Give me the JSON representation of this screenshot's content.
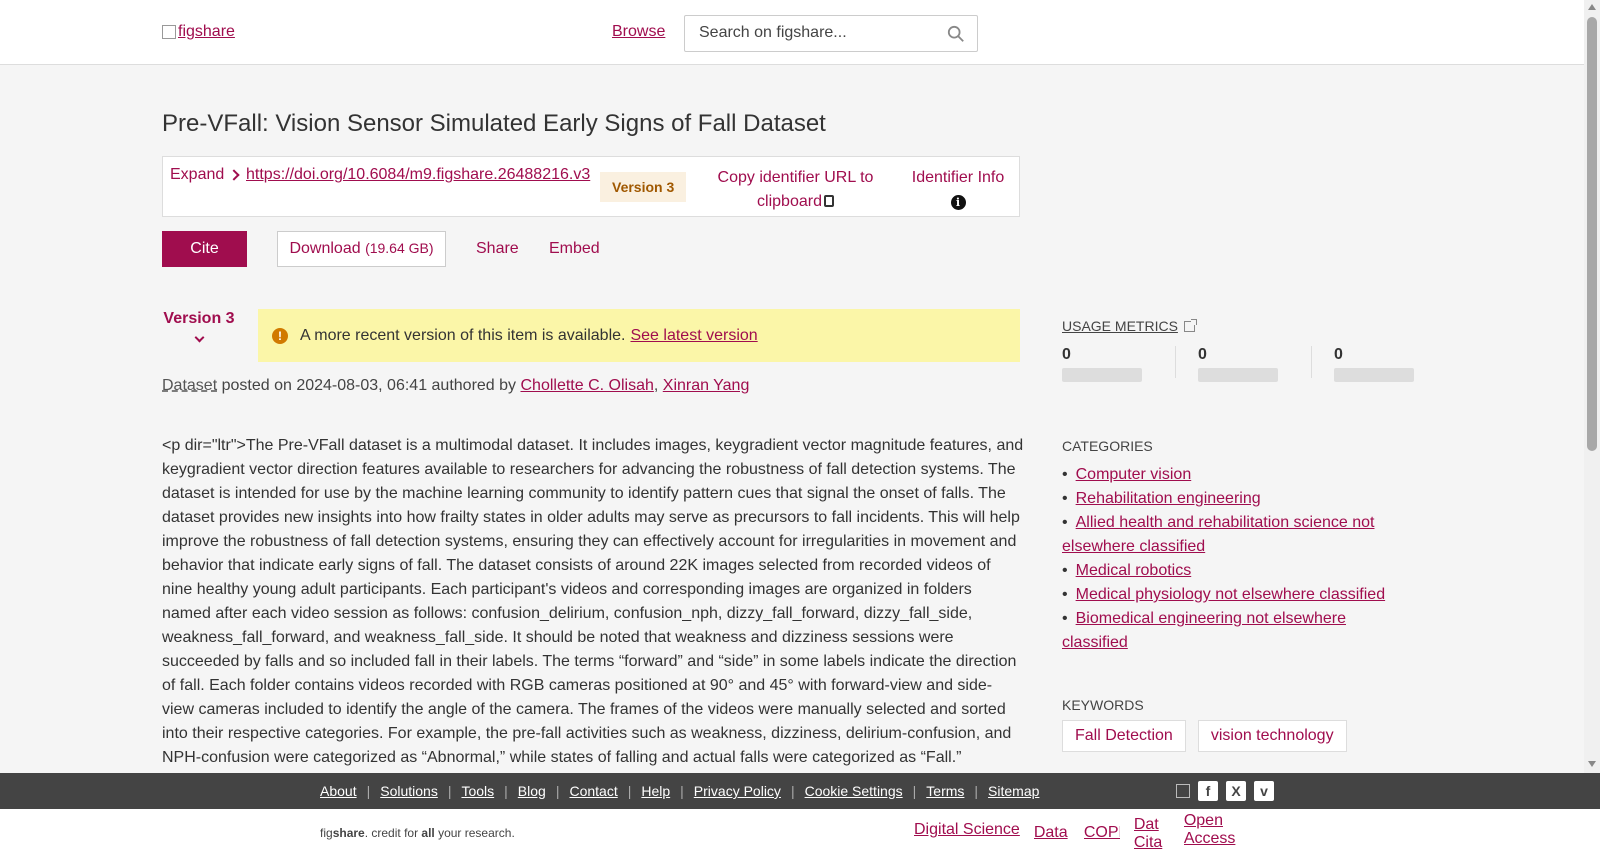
{
  "header": {
    "logo_alt": "figshare",
    "browse": "Browse",
    "search_placeholder": "Search on figshare..."
  },
  "title": "Pre-VFall: Vision Sensor Simulated Early Signs of Fall Dataset",
  "identifier": {
    "expand": "Expand",
    "doi": "https://doi.org/10.6084/m9.figshare.26488216.v3",
    "version_badge": "Version 3",
    "copy_line1": "Copy identifier URL to",
    "copy_line2": "clipboard",
    "info": "Identifier Info"
  },
  "actions": {
    "cite": "Cite",
    "download": "Download",
    "download_size": "(19.64 GB)",
    "share": "Share",
    "embed": "Embed"
  },
  "version_selector": "Version 3",
  "alert": {
    "text": "A more recent version of this item is available.",
    "link": "See latest version"
  },
  "meta": {
    "type": "Dataset",
    "posted_prefix": " posted on 2024-08-03, 06:41 authored by ",
    "author1": "Chollette C. Olisah",
    "sep": ", ",
    "author2": "Xinran Yang"
  },
  "description": "<p dir=\"ltr\">The Pre-VFall dataset is a multimodal dataset. It includes images, keygradient vector magnitude features, and keygradient vector direction features available to researchers for advancing the robustness of fall detection systems. The dataset is intended for use by the machine learning community to identify pattern cues that signal the onset of falls. The dataset provides new insights into how frailty states in older adults may serve as precursors to fall incidents. This will help improve the robustness of fall detection systems, ensuring they can effectively account for irregularities in movement and behavior that indicate early signs of fall. The dataset consists of around 22K images selected from recorded videos of nine healthy young adult participants. Each participant's videos and corresponding images are organized in folders named after each video session as follows: confusion_delirium, confusion_nph, dizzy_fall_forward, dizzy_fall_side, weakness_fall_forward, and weakness_fall_side. It should be noted that weakness and dizziness sessions were succeeded by falls and so included fall in their labels. The terms “forward” and “side” in some labels indicate the direction of fall. Each folder contains videos recorded with RGB cameras positioned at 90° and 45° with forward-view and side-view cameras included to identify the angle of the camera. The frames of the videos were manually selected and sorted into their respective categories. For example, the pre-fall activities such as weakness, dizziness, delirium-confusion, and NPH-confusion were categorized as “Abnormal,” while states of falling and actual falls were categorized as “Fall.”",
  "sidebar": {
    "usage_metrics": "USAGE METRICS",
    "metrics": [
      "0",
      "0",
      "0"
    ],
    "categories_label": "CATEGORIES",
    "categories": [
      "Computer vision",
      "Rehabilitation engineering",
      "Allied health and rehabilitation science not elsewhere classified",
      "Medical robotics",
      "Medical physiology not elsewhere classified",
      "Biomedical engineering not elsewhere classified"
    ],
    "keywords_label": "KEYWORDS",
    "keywords": [
      "Fall Detection",
      "vision technology"
    ]
  },
  "footer": {
    "links": [
      "About",
      "Solutions",
      "Tools",
      "Blog",
      "Contact",
      "Help",
      "Privacy Policy",
      "Cookie Settings",
      "Terms",
      "Sitemap"
    ],
    "credit_fig": "fig",
    "credit_share": "share",
    "credit_mid": ". credit for ",
    "credit_all": "all",
    "credit_end": " your research.",
    "partners": [
      "Digital Science",
      "Data",
      "COPE",
      "Dat Cita",
      "Open Access"
    ]
  },
  "colors": {
    "brand": "#a00d4e",
    "alert_bg": "#fbf6a8",
    "footer_bg": "#444444"
  }
}
